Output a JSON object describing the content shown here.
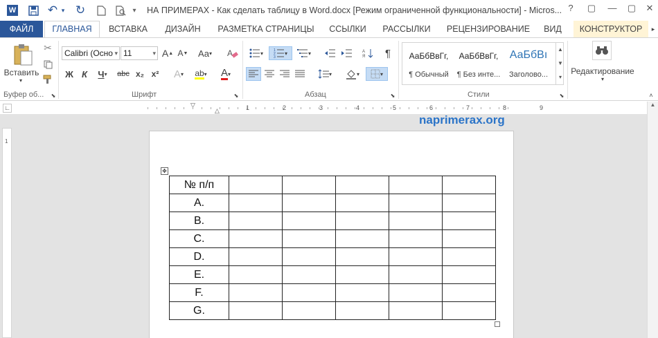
{
  "window": {
    "title": "НА ПРИМЕРАХ - Как сделать таблицу в Word.docx [Режим ограниченной функциональности] - Micros...",
    "controls": [
      "?",
      "▢",
      "—",
      "▢",
      "✕"
    ]
  },
  "qat": {
    "word_icon": "W",
    "save_icon": "floppy",
    "undo_icon": "↶",
    "redo_icon": "↻",
    "new_icon": "doc",
    "preview_icon": "print-preview",
    "customize_icon": "▾"
  },
  "tabs": [
    {
      "label": "ФАЙЛ"
    },
    {
      "label": "ГЛАВНАЯ"
    },
    {
      "label": "ВСТАВКА"
    },
    {
      "label": "ДИЗАЙН"
    },
    {
      "label": "РАЗМЕТКА СТРАНИЦЫ"
    },
    {
      "label": "ССЫЛКИ"
    },
    {
      "label": "РАССЫЛКИ"
    },
    {
      "label": "РЕЦЕНЗИРОВАНИЕ"
    },
    {
      "label": "ВИД"
    },
    {
      "label": "КОНСТРУКТОР"
    }
  ],
  "ribbon": {
    "clipboard": {
      "paste_label": "Вставить",
      "group_label": "Буфер об..."
    },
    "font": {
      "font_name": "Calibri (Осно",
      "font_size": "11",
      "grow": "A",
      "shrink": "A",
      "case": "Aa",
      "bold": "Ж",
      "italic": "К",
      "underline": "Ч",
      "strike": "abc",
      "subscript": "x₂",
      "superscript": "x²",
      "effects": "A",
      "highlight": "ab",
      "color": "A",
      "group_label": "Шрифт"
    },
    "paragraph": {
      "pilcrow": "¶",
      "group_label": "Абзац"
    },
    "styles": {
      "items": [
        {
          "sample": "АаБбВвГг,",
          "name": "¶ Обычный"
        },
        {
          "sample": "АаБбВвГг,",
          "name": "¶ Без инте..."
        },
        {
          "sample": "АаБбВı",
          "name": "Заголово..."
        }
      ],
      "group_label": "Стили"
    },
    "editing": {
      "label": "Редактирование"
    },
    "accent_color": "#2b579a"
  },
  "ruler": {
    "numbers": [
      "1",
      "2",
      "3",
      "4",
      "5",
      "6",
      "7",
      "8",
      "9"
    ],
    "vertical_number": "1"
  },
  "watermark": "naprimerax.org",
  "table": {
    "header": "№ п/п",
    "rows": [
      "A.",
      "B.",
      "C.",
      "D.",
      "E.",
      "F.",
      "G."
    ],
    "extra_columns": 5
  }
}
